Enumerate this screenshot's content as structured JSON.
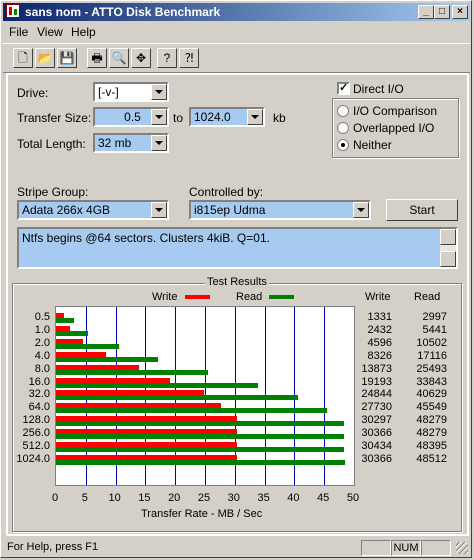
{
  "window": {
    "title": "sans nom - ATTO Disk Benchmark"
  },
  "menu": [
    "File",
    "View",
    "Help"
  ],
  "toolbar": [
    "new-icon",
    "open-icon",
    "save-icon",
    "print-icon",
    "print-preview-icon",
    "move-icon",
    "help-icon",
    "context-help-icon"
  ],
  "form": {
    "drive_label": "Drive:",
    "drive_value": "[-v-]",
    "transfer_label": "Transfer Size:",
    "transfer_from": "0.5",
    "to_label": "to",
    "transfer_to": "1024.0",
    "unit": "kb",
    "total_label": "Total Length:",
    "total_value": "32 mb",
    "direct_io": "Direct I/O",
    "io_comparison": "I/O Comparison",
    "overlapped": "Overlapped I/O",
    "neither": "Neither",
    "stripe_label": "Stripe Group:",
    "stripe_value": "Adata 266x 4GB",
    "controlled_label": "Controlled by:",
    "controlled_value": "i815ep Udma",
    "start": "Start",
    "description": "Ntfs begins @64 sectors. Clusters 4kiB. Q=01."
  },
  "results": {
    "title": "Test Results",
    "write_col": "Write",
    "read_col": "Read",
    "legend_write": "Write",
    "legend_read": "Read"
  },
  "chart_data": {
    "type": "bar",
    "categories": [
      "0.5",
      "1.0",
      "2.0",
      "4.0",
      "8.0",
      "16.0",
      "32.0",
      "64.0",
      "128.0",
      "256.0",
      "512.0",
      "1024.0"
    ],
    "series": [
      {
        "name": "Write",
        "values": [
          1331,
          2432,
          4596,
          8326,
          13873,
          19193,
          24844,
          27730,
          30297,
          30366,
          30434,
          30366
        ],
        "color": "#ff0000"
      },
      {
        "name": "Read",
        "values": [
          2997,
          5441,
          10502,
          17116,
          25493,
          33843,
          40629,
          45549,
          48279,
          48279,
          48395,
          48512
        ],
        "color": "#008000"
      }
    ],
    "xlabel": "Transfer Rate - MB / Sec",
    "xlim": [
      0,
      50
    ],
    "xticks": [
      "0",
      "5",
      "10",
      "15",
      "20",
      "25",
      "30",
      "35",
      "40",
      "45",
      "50"
    ],
    "grid": true
  },
  "status": {
    "help": "For Help, press F1",
    "num": "NUM"
  }
}
